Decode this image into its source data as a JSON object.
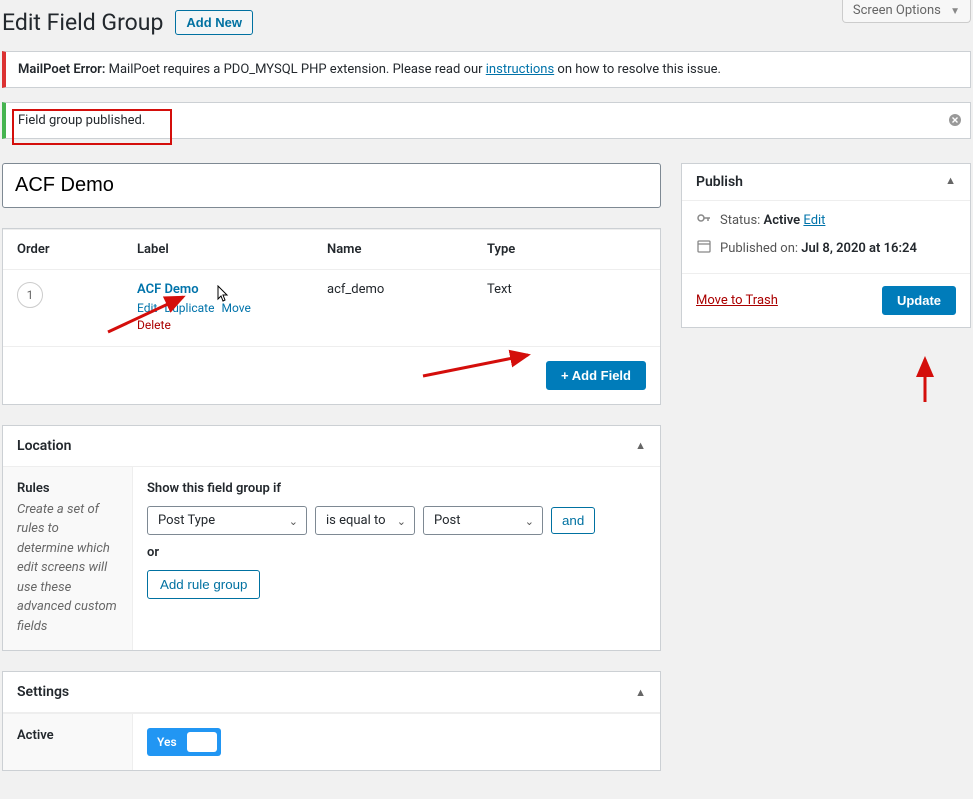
{
  "screen_options": {
    "label": "Screen Options"
  },
  "page_title": "Edit Field Group",
  "add_new_label": "Add New",
  "mailpoet_error": {
    "prefix": "MailPoet Error:",
    "msg_before": " MailPoet requires a PDO_MYSQL PHP extension. Please read our ",
    "link": "instructions",
    "msg_after": " on how to resolve this issue."
  },
  "published_notice": "Field group published.",
  "title_value": "ACF Demo",
  "fields": {
    "head_order": "Order",
    "head_label": "Label",
    "head_name": "Name",
    "head_type": "Type",
    "row": {
      "order": "1",
      "label": "ACF Demo",
      "name": "acf_demo",
      "type": "Text",
      "actions": {
        "edit": "Edit",
        "duplicate": "Duplicate",
        "move": "Move",
        "delete": "Delete"
      }
    },
    "add_field_label": "+ Add Field"
  },
  "location": {
    "title": "Location",
    "rules_label": "Rules",
    "rules_desc": "Create a set of rules to determine which edit screens will use these advanced custom fields",
    "show_if": "Show this field group if",
    "sel_param": "Post Type",
    "sel_op": "is equal to",
    "sel_value": "Post",
    "and_label": "and",
    "or_label": "or",
    "add_rule_group": "Add rule group"
  },
  "settings": {
    "title": "Settings",
    "active_label": "Active",
    "active_value": "Yes"
  },
  "publish": {
    "title": "Publish",
    "status_label": "Status: ",
    "status_value": "Active",
    "edit_label": "Edit",
    "published_label": "Published on: ",
    "published_value": "Jul 8, 2020 at 16:24",
    "trash_label": "Move to Trash",
    "update_label": "Update"
  }
}
